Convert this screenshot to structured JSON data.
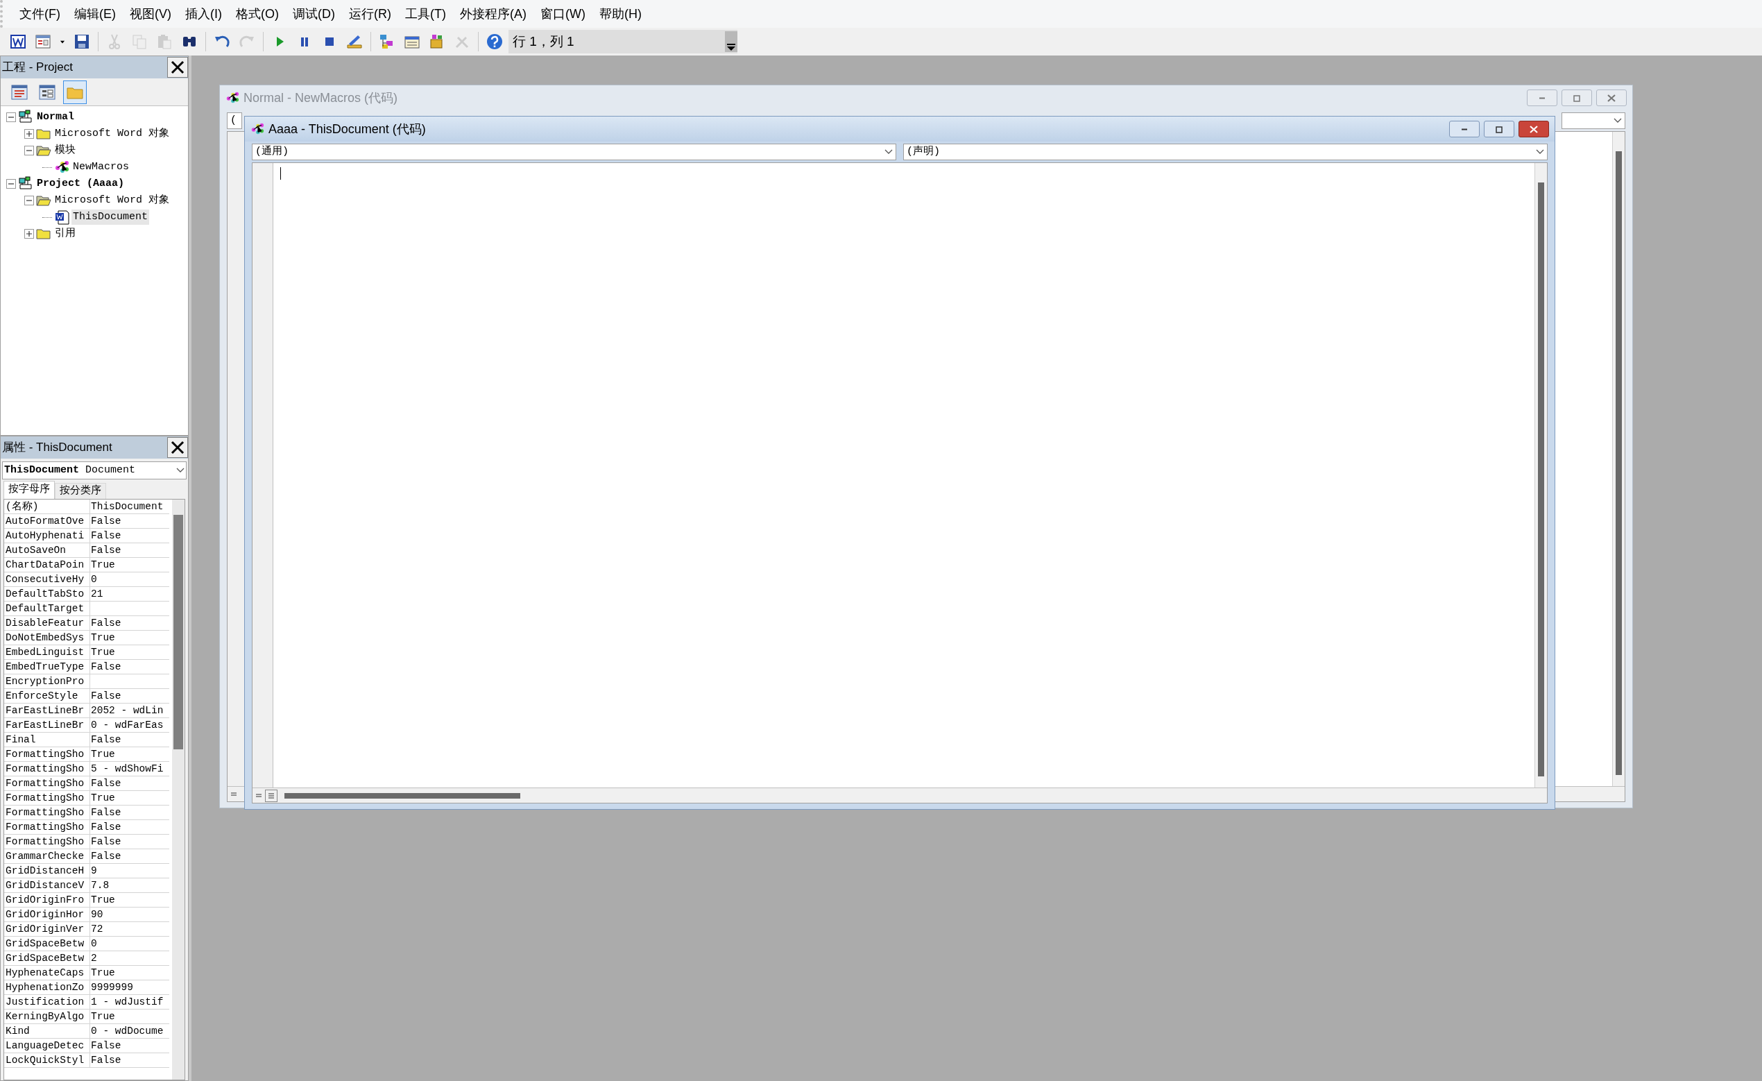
{
  "menu": [
    "文件(F)",
    "编辑(E)",
    "视图(V)",
    "插入(I)",
    "格式(O)",
    "调试(D)",
    "运行(R)",
    "工具(T)",
    "外接程序(A)",
    "窗口(W)",
    "帮助(H)"
  ],
  "toolbar": [
    {
      "kind": "word",
      "disabled": false
    },
    {
      "kind": "userform",
      "disabled": false
    },
    {
      "kind": "dropdown",
      "disabled": false
    },
    {
      "kind": "save",
      "disabled": false
    },
    {
      "kind": "sep"
    },
    {
      "kind": "cut",
      "disabled": true
    },
    {
      "kind": "copy",
      "disabled": true
    },
    {
      "kind": "paste",
      "disabled": true
    },
    {
      "kind": "find",
      "disabled": false
    },
    {
      "kind": "sep"
    },
    {
      "kind": "undo",
      "disabled": false
    },
    {
      "kind": "redo",
      "disabled": true
    },
    {
      "kind": "sep"
    },
    {
      "kind": "run",
      "disabled": false
    },
    {
      "kind": "pause",
      "disabled": false
    },
    {
      "kind": "stop",
      "disabled": false
    },
    {
      "kind": "design",
      "disabled": false
    },
    {
      "kind": "sep"
    },
    {
      "kind": "explorer",
      "disabled": false
    },
    {
      "kind": "properties",
      "disabled": false
    },
    {
      "kind": "browser",
      "disabled": false
    },
    {
      "kind": "toolbox",
      "disabled": true
    },
    {
      "kind": "sep"
    },
    {
      "kind": "help",
      "disabled": false
    }
  ],
  "cursor_position": "行 1，列 1",
  "project_panel": {
    "title": "工程 - Project",
    "buttons": [
      {
        "kind": "code",
        "pressed": false
      },
      {
        "kind": "object",
        "pressed": false
      },
      {
        "kind": "folders",
        "pressed": true
      }
    ],
    "tree": [
      {
        "label": "Normal",
        "kind": "project",
        "expanded": true,
        "selected": false,
        "children": [
          {
            "label": "Microsoft Word 对象",
            "kind": "folder",
            "expanded": false,
            "selected": false
          },
          {
            "label": "模块",
            "kind": "folder",
            "expanded": true,
            "selected": false,
            "children": [
              {
                "label": "NewMacros",
                "kind": "module",
                "selected": false
              }
            ]
          }
        ]
      },
      {
        "label": "Project (Aaaa)",
        "kind": "project",
        "expanded": true,
        "selected": false,
        "children": [
          {
            "label": "Microsoft Word 对象",
            "kind": "folder",
            "expanded": true,
            "selected": false,
            "children": [
              {
                "label": "ThisDocument",
                "kind": "document",
                "selected": true
              }
            ]
          },
          {
            "label": "引用",
            "kind": "folder",
            "expanded": false,
            "selected": false
          }
        ]
      }
    ]
  },
  "properties_panel": {
    "title": "属性 - ThisDocument",
    "object": "**ThisDocument** Document",
    "tabs": [
      {
        "label": "按字母序",
        "selected": true
      },
      {
        "label": "按分类序",
        "selected": false
      }
    ],
    "rows": [
      {
        "name": "(名称)",
        "value": "ThisDocument"
      },
      {
        "name": "AutoFormatOve",
        "value": "False"
      },
      {
        "name": "AutoHyphenati",
        "value": "False"
      },
      {
        "name": "AutoSaveOn",
        "value": "False"
      },
      {
        "name": "ChartDataPoin",
        "value": "True"
      },
      {
        "name": "ConsecutiveHy",
        "value": "0"
      },
      {
        "name": "DefaultTabSto",
        "value": "21"
      },
      {
        "name": "DefaultTarget",
        "value": ""
      },
      {
        "name": "DisableFeatur",
        "value": "False"
      },
      {
        "name": "DoNotEmbedSys",
        "value": "True"
      },
      {
        "name": "EmbedLinguist",
        "value": "True"
      },
      {
        "name": "EmbedTrueType",
        "value": "False"
      },
      {
        "name": "EncryptionPro",
        "value": ""
      },
      {
        "name": "EnforceStyle",
        "value": "False"
      },
      {
        "name": "FarEastLineBr",
        "value": "2052 - wdLin"
      },
      {
        "name": "FarEastLineBr",
        "value": "0 - wdFarEas"
      },
      {
        "name": "Final",
        "value": "False"
      },
      {
        "name": "FormattingSho",
        "value": "True"
      },
      {
        "name": "FormattingSho",
        "value": "5 - wdShowFi"
      },
      {
        "name": "FormattingSho",
        "value": "False"
      },
      {
        "name": "FormattingSho",
        "value": "True"
      },
      {
        "name": "FormattingSho",
        "value": "False"
      },
      {
        "name": "FormattingSho",
        "value": "False"
      },
      {
        "name": "FormattingSho",
        "value": "False"
      },
      {
        "name": "GrammarChecke",
        "value": "False"
      },
      {
        "name": "GridDistanceH",
        "value": "9"
      },
      {
        "name": "GridDistanceV",
        "value": "7.8"
      },
      {
        "name": "GridOriginFro",
        "value": "True"
      },
      {
        "name": "GridOriginHor",
        "value": "90"
      },
      {
        "name": "GridOriginVer",
        "value": "72"
      },
      {
        "name": "GridSpaceBetw",
        "value": "0"
      },
      {
        "name": "GridSpaceBetw",
        "value": "2"
      },
      {
        "name": "HyphenateCaps",
        "value": "True"
      },
      {
        "name": "HyphenationZo",
        "value": "9999999"
      },
      {
        "name": "Justification",
        "value": "1 - wdJustif"
      },
      {
        "name": "KerningByAlgo",
        "value": "True"
      },
      {
        "name": "Kind",
        "value": "0 - wdDocume"
      },
      {
        "name": "LanguageDetec",
        "value": "False"
      },
      {
        "name": "LockQuickStyl",
        "value": "False"
      }
    ]
  },
  "windows": [
    {
      "title": "Normal - NewMacros (代码)",
      "active": false,
      "object_combo": "("
    },
    {
      "title": "Aaaa - ThisDocument (代码)",
      "active": true,
      "object_combo": "(通用)",
      "procedure_combo": "(声明)"
    }
  ]
}
